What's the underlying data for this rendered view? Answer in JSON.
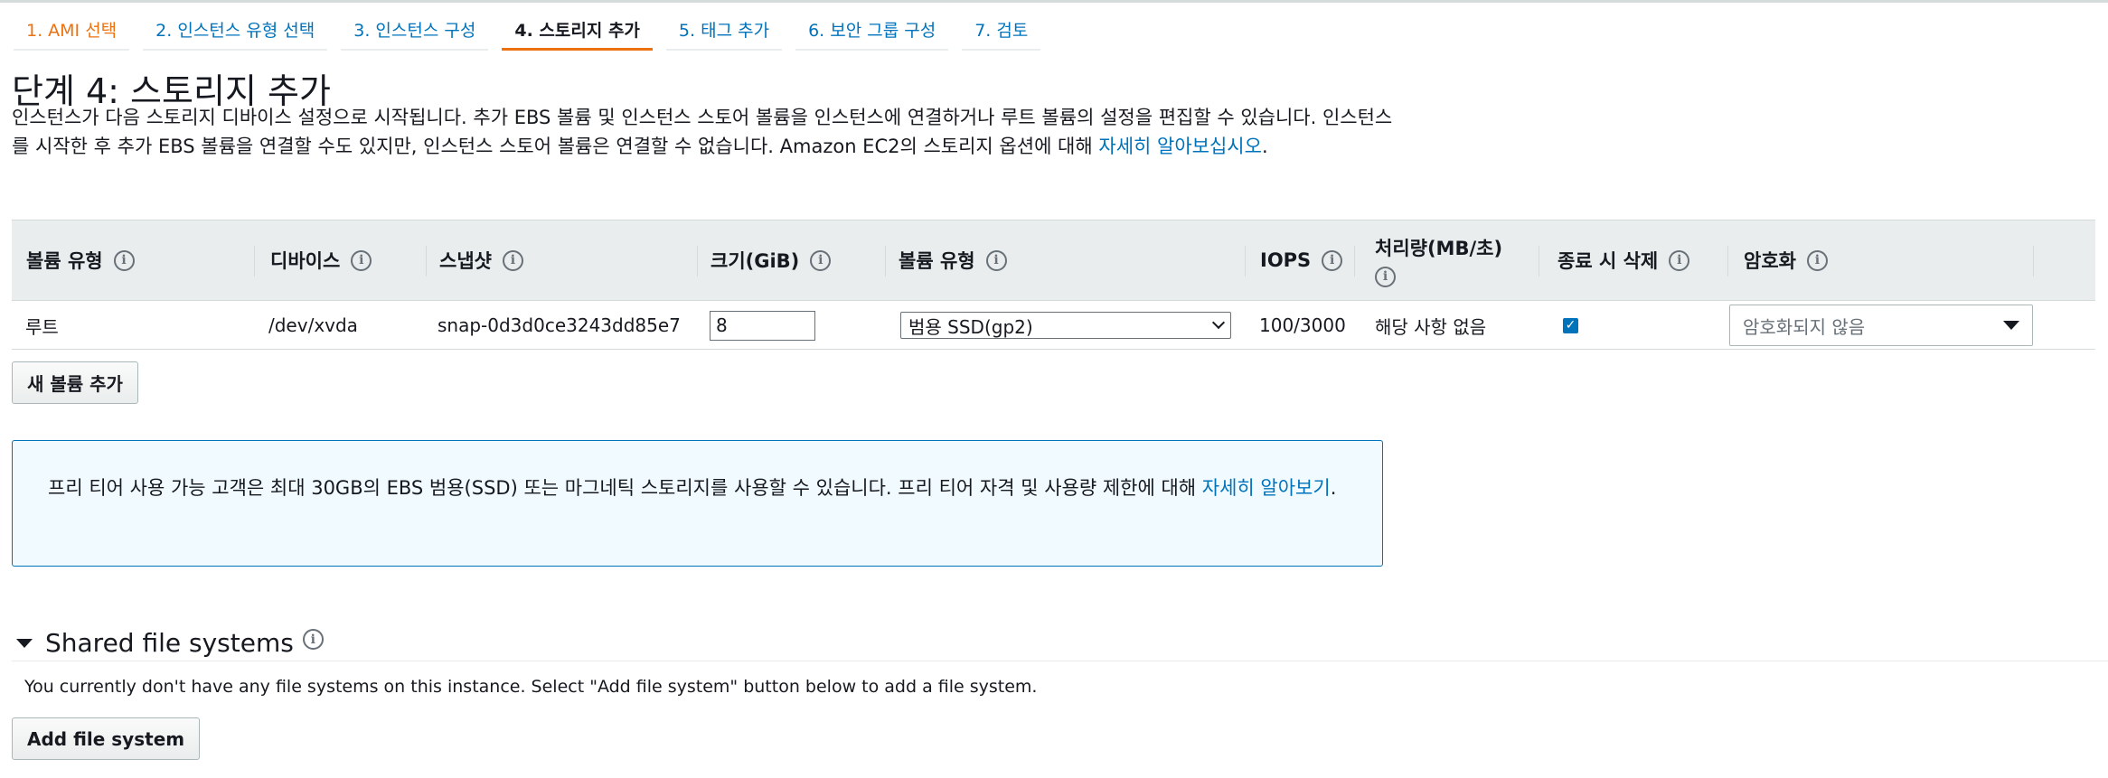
{
  "wizard_tabs": [
    {
      "label": "1. AMI 선택",
      "state": "done"
    },
    {
      "label": "2. 인스턴스 유형 선택",
      "state": "link"
    },
    {
      "label": "3. 인스턴스 구성",
      "state": "link"
    },
    {
      "label": "4. 스토리지 추가",
      "state": "active"
    },
    {
      "label": "5. 태그 추가",
      "state": "link"
    },
    {
      "label": "6. 보안 그룹 구성",
      "state": "link"
    },
    {
      "label": "7. 검토",
      "state": "link"
    }
  ],
  "page": {
    "title": "단계 4: 스토리지 추가",
    "intro_text": "인스턴스가 다음 스토리지 디바이스 설정으로 시작됩니다. 추가 EBS 볼륨 및 인스턴스 스토어 볼륨을 인스턴스에 연결하거나 루트 볼륨의 설정을 편집할 수 있습니다. 인스턴스를 시작한 후 추가 EBS 볼륨을 연결할 수도 있지만, 인스턴스 스토어 볼륨은 연결할 수 없습니다. Amazon EC2의 스토리지 옵션에 대해 ",
    "intro_link": "자세히 알아보십시오",
    "intro_end": "."
  },
  "table": {
    "headers": {
      "volume_type": "볼륨 유형",
      "device": "디바이스",
      "snapshot": "스냅샷",
      "size": "크기(GiB)",
      "ebs_type": "볼륨 유형",
      "iops": "IOPS",
      "throughput": "처리량(MB/초)",
      "delete_on_termination": "종료 시 삭제",
      "encryption": "암호화"
    },
    "row": {
      "volume_type": "루트",
      "device": "/dev/xvda",
      "snapshot": "snap-0d3d0ce3243dd85e7",
      "size": "8",
      "ebs_type": "범용 SSD(gp2)",
      "iops": "100/3000",
      "throughput": "해당 사항 없음",
      "delete_on_termination": true,
      "encryption": "암호화되지 않음"
    }
  },
  "buttons": {
    "add_volume": "새 볼륨 추가",
    "add_file_system": "Add file system"
  },
  "free_tier": {
    "text": "프리 티어 사용 가능 고객은 최대 30GB의 EBS 범용(SSD) 또는 마그네틱 스토리지를 사용할 수 있습니다. 프리 티어 자격 및 사용량 제한에 대해 ",
    "link": "자세히 알아보기",
    "end": "."
  },
  "file_systems": {
    "title": "Shared file systems",
    "description": "You currently don't have any file systems on this instance. Select \"Add file system\" button below to add a file system."
  },
  "colors": {
    "link": "#0073bb",
    "accent": "#ec7211",
    "header_bg": "#eaeded",
    "info_bg": "#f1faff"
  }
}
